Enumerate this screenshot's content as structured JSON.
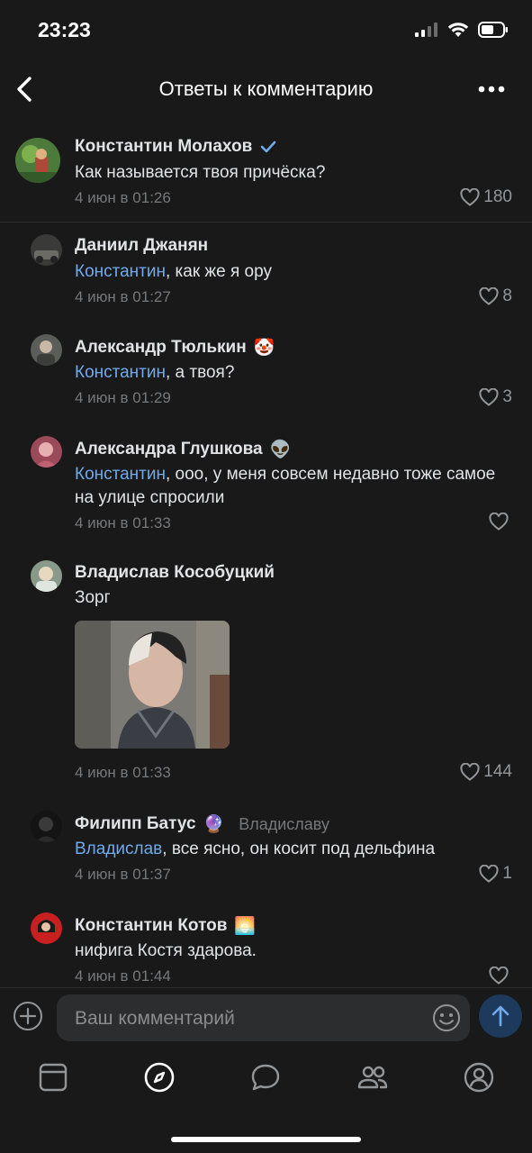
{
  "status": {
    "time": "23:23"
  },
  "header": {
    "title": "Ответы к комментарию"
  },
  "comments": [
    {
      "name": "Константин Молахов",
      "badge": "verified",
      "mention": "",
      "text": "Как называется твоя причёска?",
      "date": "4 июн в 01:26",
      "likes": "180"
    },
    {
      "name": "Даниил Джанян",
      "mention": "Константин",
      "text": ", как же я ору",
      "date": "4 июн в 01:27",
      "likes": "8"
    },
    {
      "name": "Александр Тюлькин",
      "emoji": "🤡",
      "mention": "Константин",
      "text": ", а твоя?",
      "date": "4 июн в 01:29",
      "likes": "3"
    },
    {
      "name": "Александра Глушкова",
      "emoji": "👽",
      "mention": "Константин",
      "text": ", ооо, у меня совсем недавно тоже самое на улице спросили",
      "date": "4 июн в 01:33",
      "likes": ""
    },
    {
      "name": "Владислав Кособуцкий",
      "mention": "",
      "text": "Зорг",
      "date": "4 июн в 01:33",
      "likes": "144"
    },
    {
      "name": "Филипп Батус",
      "emoji": "🔮",
      "reply_to": "Владиславу",
      "mention": "Владислав",
      "text": ", все ясно, он косит под дельфина",
      "date": "4 июн в 01:37",
      "likes": "1"
    },
    {
      "name": "Константин Котов",
      "emoji": "🌅",
      "mention": "",
      "text": "нифига Костя здарова.",
      "date": "4 июн в 01:44",
      "likes": ""
    }
  ],
  "composer": {
    "placeholder": "Ваш комментарий"
  },
  "tabs": [
    "news",
    "discover",
    "messages",
    "friends",
    "profile"
  ],
  "colors": {
    "background": "#19191a",
    "accent": "#71aaeb",
    "secondary": "#76787a"
  }
}
